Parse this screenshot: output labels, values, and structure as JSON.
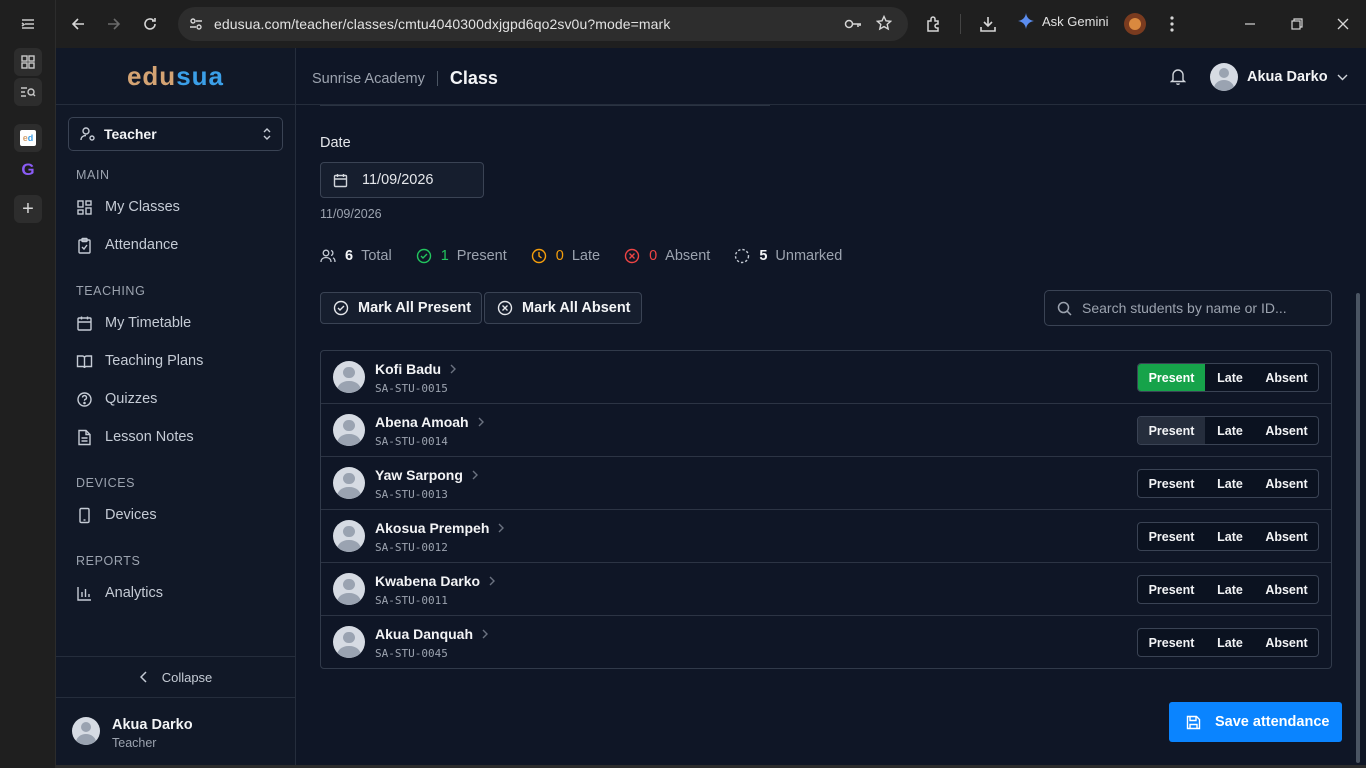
{
  "browser": {
    "url": "edusua.com/teacher/classes/cmtu4040300dxjgpd6qo2sv0u?mode=mark",
    "ask_gemini": "Ask Gemini"
  },
  "app": {
    "logo_part1": "edu",
    "logo_part2": "sua",
    "role": "Teacher",
    "sections": {
      "main": "MAIN",
      "teaching": "TEACHING",
      "devices": "DEVICES",
      "reports": "REPORTS"
    },
    "nav": {
      "my_classes": "My Classes",
      "attendance": "Attendance",
      "my_timetable": "My Timetable",
      "teaching_plans": "Teaching Plans",
      "quizzes": "Quizzes",
      "lesson_notes": "Lesson Notes",
      "devices": "Devices",
      "analytics": "Analytics"
    },
    "collapse": "Collapse",
    "user": {
      "name": "Akua Darko",
      "role": "Teacher"
    }
  },
  "topbar": {
    "school": "Sunrise Academy",
    "page": "Class",
    "user_name": "Akua Darko"
  },
  "form": {
    "date_label": "Date",
    "date_value": "11/09/2026",
    "date_hint": "11/09/2026"
  },
  "stats": {
    "total": {
      "count": "6",
      "label": "Total"
    },
    "present": {
      "count": "1",
      "label": "Present"
    },
    "late": {
      "count": "0",
      "label": "Late"
    },
    "absent": {
      "count": "0",
      "label": "Absent"
    },
    "unmarked": {
      "count": "5",
      "label": "Unmarked"
    }
  },
  "actions": {
    "mark_all_present": "Mark All Present",
    "mark_all_absent": "Mark All Absent",
    "search_placeholder": "Search students by name or ID...",
    "save": "Save attendance"
  },
  "status_labels": {
    "present": "Present",
    "late": "Late",
    "absent": "Absent"
  },
  "students": [
    {
      "name": "Kofi Badu",
      "id": "SA-STU-0015",
      "status": "present"
    },
    {
      "name": "Abena Amoah",
      "id": "SA-STU-0014",
      "status": ""
    },
    {
      "name": "Yaw Sarpong",
      "id": "SA-STU-0013",
      "status": ""
    },
    {
      "name": "Akosua Prempeh",
      "id": "SA-STU-0012",
      "status": ""
    },
    {
      "name": "Kwabena Darko",
      "id": "SA-STU-0011",
      "status": ""
    },
    {
      "name": "Akua Danquah",
      "id": "SA-STU-0045",
      "status": ""
    }
  ],
  "colors": {
    "present": "#16a34a",
    "late": "#f59e0b",
    "absent": "#ef4444",
    "accent": "#0a84ff"
  }
}
